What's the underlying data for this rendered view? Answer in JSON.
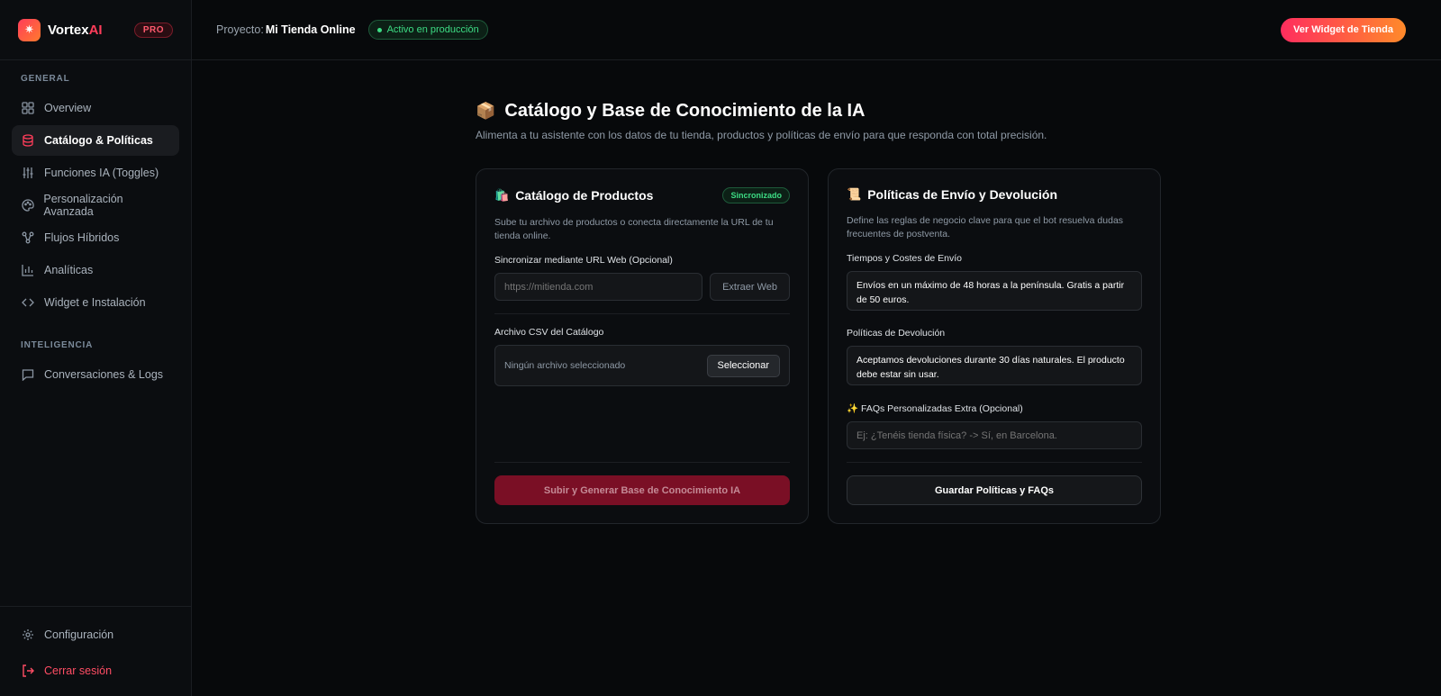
{
  "brand": {
    "name_main": "Vortex",
    "name_accent": "AI",
    "badge": "PRO",
    "logo_icon": "sparkles-icon"
  },
  "sidebar": {
    "section_general": "GENERAL",
    "section_intel": "INTELIGENCIA",
    "items": [
      {
        "label": "Overview",
        "icon": "grid-icon"
      },
      {
        "label": "Catálogo & Políticas",
        "icon": "database-icon"
      },
      {
        "label": "Funciones IA (Toggles)",
        "icon": "sliders-icon"
      },
      {
        "label": "Personalización Avanzada",
        "icon": "palette-icon"
      },
      {
        "label": "Flujos Híbridos",
        "icon": "workflow-icon"
      },
      {
        "label": "Analíticas",
        "icon": "bar-chart-icon"
      },
      {
        "label": "Widget e Instalación",
        "icon": "code-icon"
      }
    ],
    "intel_items": [
      {
        "label": "Conversaciones & Logs",
        "icon": "message-icon"
      }
    ],
    "footer": {
      "settings": "Configuración",
      "logout": "Cerrar sesión"
    }
  },
  "header": {
    "project_label": "Proyecto:",
    "project_name": "Mi Tienda Online",
    "status": "Activo en producción",
    "widget_button": "Ver Widget de Tienda"
  },
  "main": {
    "title_emoji": "📦",
    "title": "Catálogo y Base de Conocimiento de la IA",
    "subtitle": "Alimenta a tu asistente con los datos de tu tienda, productos y políticas de envío para que responda con total precisión."
  },
  "catalog": {
    "emoji": "🛍️",
    "title": "Catálogo de Productos",
    "badge": "Sincronizado",
    "desc": "Sube tu archivo de productos o conecta directamente la URL de tu tienda online.",
    "url_label": "Sincronizar mediante URL Web (Opcional)",
    "url_placeholder": "https://mitienda.com",
    "extract_button": "Extraer Web",
    "csv_label": "Archivo CSV del Catálogo",
    "no_file": "Ningún archivo seleccionado",
    "select_button": "Seleccionar",
    "submit_button": "Subir y Generar Base de Conocimiento IA"
  },
  "policies": {
    "emoji": "📜",
    "title": "Políticas de Envío y Devolución",
    "desc": "Define las reglas de negocio clave para que el bot resuelva dudas frecuentes de postventa.",
    "shipping_label": "Tiempos y Costes de Envío",
    "shipping_value": "Envíos en un máximo de 48 horas a la península. Gratis a partir de 50 euros.",
    "returns_label": "Políticas de Devolución",
    "returns_value": "Aceptamos devoluciones durante 30 días naturales. El producto debe estar sin usar.",
    "faq_emoji": "✨",
    "faq_label": "FAQs Personalizadas Extra (Opcional)",
    "faq_placeholder": "Ej: ¿Tenéis tienda física? -> Sí, en Barcelona.",
    "save_button": "Guardar Políticas y FAQs"
  }
}
